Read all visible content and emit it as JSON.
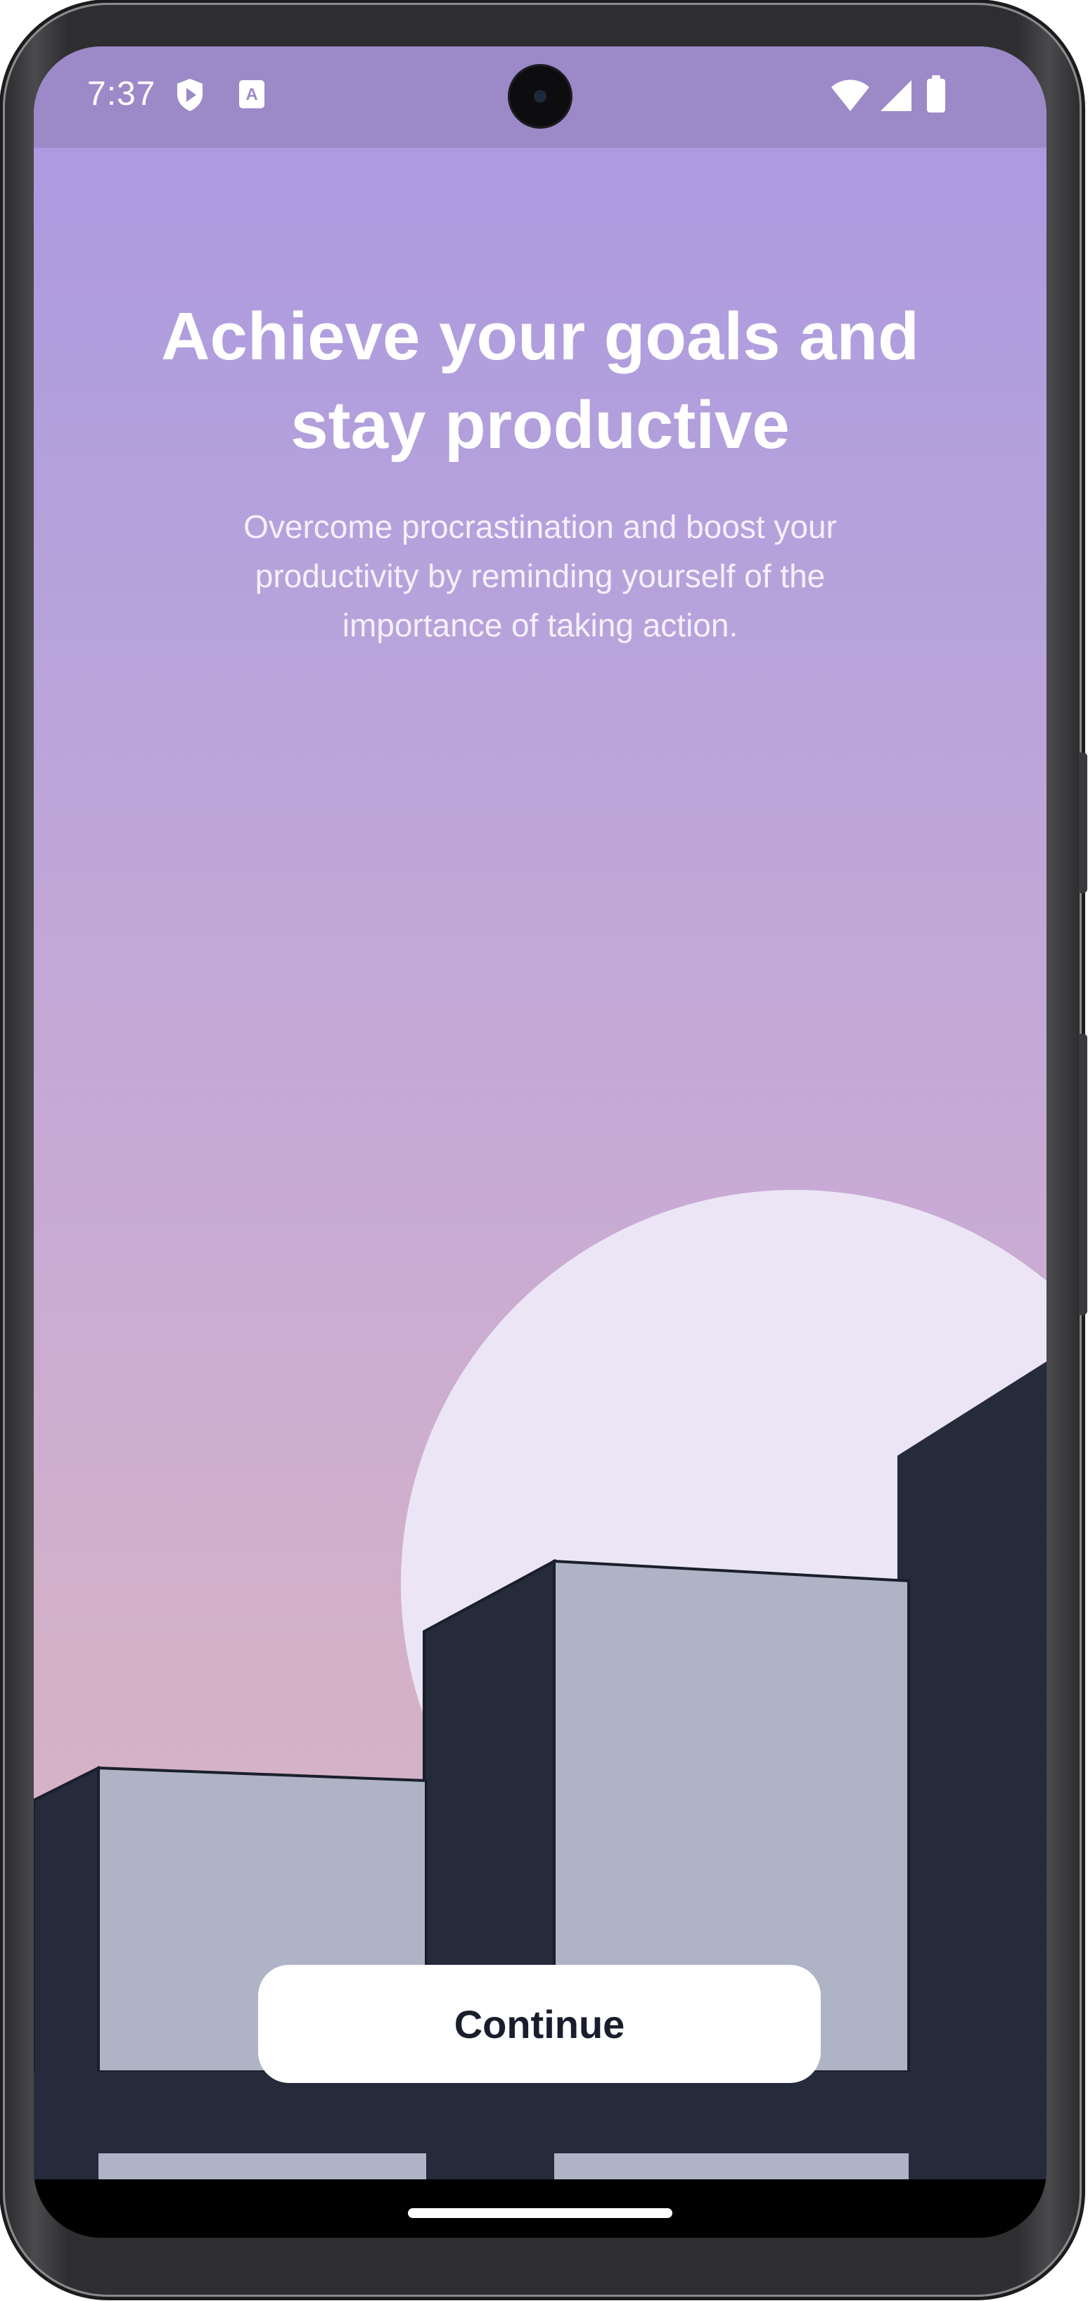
{
  "status_bar": {
    "time": "7:37",
    "left_icons": [
      "shield-play-icon",
      "accessibility-a-icon"
    ],
    "right_icons": [
      "wifi-icon",
      "cellular-signal-icon",
      "battery-icon"
    ]
  },
  "onboarding": {
    "title": "Achieve your goals and stay productive",
    "description": "Overcome procrastination and boost your productivity by reminding yourself of the importance of taking action.",
    "illustration": "city-buildings-with-moon",
    "continue_label": "Continue"
  },
  "colors": {
    "background_top": "#ab98e1",
    "background_bottom": "#d8b3c4",
    "moon": "#ebe5f5",
    "building_dark": "#252b3b",
    "building_light": "#aeb3c6",
    "button_bg": "#ffffff",
    "button_text": "#1a1d2b"
  }
}
